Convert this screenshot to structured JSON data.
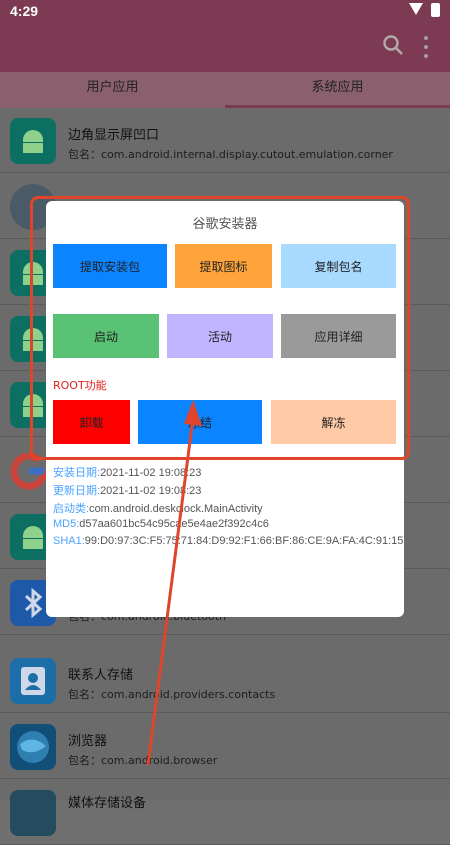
{
  "status": {
    "time": "4:29"
  },
  "tabs": [
    "用户应用",
    "系统应用"
  ],
  "apps": [
    {
      "name": "边角显示屏凹口",
      "pkg": "包名：com.android.internal.display.cutout.emulation.corner",
      "icon": "android-icon"
    },
    {
      "name": "",
      "pkg": "",
      "icon": "settings-icon"
    },
    {
      "name": "",
      "pkg": "",
      "icon": "android-icon"
    },
    {
      "name": "",
      "pkg": "",
      "icon": "android-icon"
    },
    {
      "name": "",
      "pkg": "",
      "icon": "android-icon"
    },
    {
      "name": "",
      "pkg": "",
      "icon": "google-icon"
    },
    {
      "name": "",
      "pkg": "",
      "icon": "android-icon"
    },
    {
      "name": "",
      "pkg": "包名：com.android.bluetooth",
      "icon": "bluetooth-icon"
    },
    {
      "name": "联系人存储",
      "pkg": "包名：com.android.providers.contacts",
      "icon": "contacts-icon"
    },
    {
      "name": "浏览器",
      "pkg": "包名：com.android.browser",
      "icon": "browser-icon"
    },
    {
      "name": "媒体存储设备",
      "pkg": "",
      "icon": "media-icon"
    }
  ],
  "dialog": {
    "title": "谷歌安装器",
    "buttons_row1": [
      "提取安装包",
      "提取图标",
      "复制包名"
    ],
    "buttons_row2": [
      "启动",
      "活动",
      "应用详细"
    ],
    "root_label": "ROOT功能",
    "root_buttons": [
      "卸载",
      "冻结",
      "解冻"
    ],
    "info": [
      {
        "key": "安装日期:",
        "value": "2021-11-02 19:08:23"
      },
      {
        "key": "更新日期:",
        "value": "2021-11-02 19:08:23"
      },
      {
        "key": "启动类:",
        "value": "com.android.deskclock.MainActivity"
      },
      {
        "key": "MD5:",
        "value": "d57aa601bc54c95cae5e4ae2f392c4c6"
      },
      {
        "key": "SHA1:",
        "value": "99:D0:97:3C:F5:75:71:84:D9:92:F1:66:BF:86:CE:9A:FA:4C:91:15"
      }
    ]
  },
  "colors": {
    "accent": "#7c3b52",
    "btn_blue": "#0a84ff",
    "btn_orange": "#ffa43b",
    "btn_lightblue": "#a8d9ff",
    "btn_green": "#59c274",
    "btn_lavender": "#c2b5ff",
    "btn_gray": "#9a9a9a",
    "btn_red": "#ff0000",
    "btn_peach": "#ffc9a6",
    "highlight": "#e0452c"
  }
}
